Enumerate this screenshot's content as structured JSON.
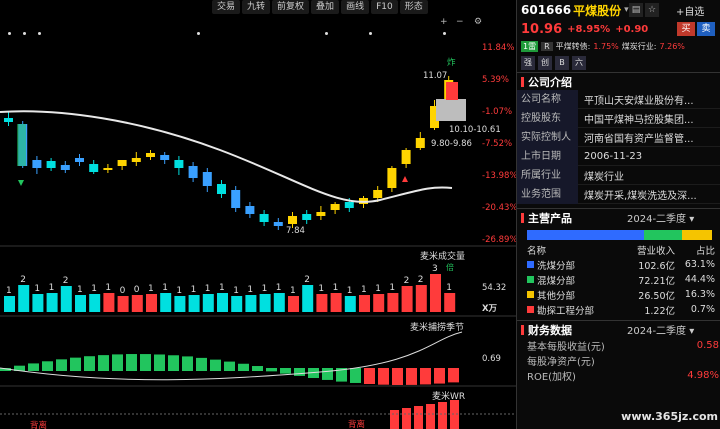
{
  "toolbar": {
    "trade": "交易",
    "nine": "九转",
    "adjust": "前复权",
    "overlay": "叠加",
    "draw": "画线",
    "f10": "F10",
    "shape": "形态"
  },
  "chart_icons": {
    "add": "+",
    "remove": "−",
    "settings": "⚙"
  },
  "price_axis": [
    "11.84%",
    "5.39%",
    "-1.07%",
    "-7.52%",
    "-13.98%",
    "-20.43%",
    "-26.89%"
  ],
  "annotations": {
    "high": "11.07",
    "low": "7.84",
    "range1": "9.80-9.86",
    "range2": "10.10-10.61",
    "char_zha": "炸"
  },
  "volume": {
    "title": "麦米成交量",
    "right_value": "54.32",
    "unit": "X万",
    "numbers": [
      "1",
      "2",
      "1",
      "1",
      "2",
      "1",
      "1",
      "1",
      "0",
      "0",
      "1",
      "1",
      "1",
      "1",
      "1",
      "1",
      "1",
      "1",
      "1",
      "1",
      "1",
      "2",
      "1",
      "1",
      "1",
      "1",
      "1",
      "1",
      "2",
      "2",
      "3",
      "1"
    ],
    "badge": "倍"
  },
  "season": {
    "title": "麦米捕捞季节",
    "right_value": "0.69"
  },
  "wr": {
    "title": "麦米WR",
    "label_left": "背离",
    "label_mid": "背离"
  },
  "stock": {
    "code": "601666",
    "name": "平煤股份",
    "chevron": "▾",
    "price": "10.96",
    "pct": "+8.95%",
    "chg": "+0.90",
    "self_select": "+自选",
    "buy": "买",
    "sell": "卖",
    "tag_num": "1",
    "tag_lei": "雷",
    "tag_r": "R",
    "bond_label": "平煤转债:",
    "bond_pct": "1.75%",
    "industry_label": "煤炭行业:",
    "industry_pct": "7.26%",
    "chips": [
      "强",
      "创",
      "B",
      "六"
    ]
  },
  "company": {
    "title": "公司介绍",
    "rows": [
      {
        "k": "公司名称",
        "v": "平顶山天安煤业股份有..."
      },
      {
        "k": "控股股东",
        "v": "中国平煤神马控股集团..."
      },
      {
        "k": "实际控制人",
        "v": "河南省国有资产监督管..."
      },
      {
        "k": "上市日期",
        "v": "2006-11-23"
      },
      {
        "k": "所属行业",
        "v": "煤炭行业"
      },
      {
        "k": "业务范围",
        "v": "煤炭开采,煤炭洗选及深..."
      }
    ]
  },
  "products": {
    "title": "主营产品",
    "period": "2024-二季度 ▾",
    "headers": [
      "名称",
      "营业收入",
      "占比"
    ],
    "shares": [
      63.1,
      16.3
    ],
    "rows": [
      {
        "name": "洗煤分部",
        "rev": "102.6亿",
        "pct": "63.1%",
        "color": "#2f6bff"
      },
      {
        "name": "混煤分部",
        "rev": "72.21亿",
        "pct": "44.4%",
        "color": "#22c55e"
      },
      {
        "name": "其他分部",
        "rev": "26.50亿",
        "pct": "16.3%",
        "color": "#f5c400"
      },
      {
        "name": "勘探工程分部",
        "rev": "1.22亿",
        "pct": "0.7%",
        "color": "#ff3b3b"
      }
    ]
  },
  "finance": {
    "title": "财务数据",
    "period": "2024-二季度 ▾",
    "rows": [
      {
        "k": "基本每股收益(元)",
        "v": "0.58"
      },
      {
        "k": "每股净资产(元)",
        "v": ""
      },
      {
        "k": "ROE(加权)",
        "v": "4.98%"
      }
    ]
  },
  "watermark": "www.365jz.com"
}
